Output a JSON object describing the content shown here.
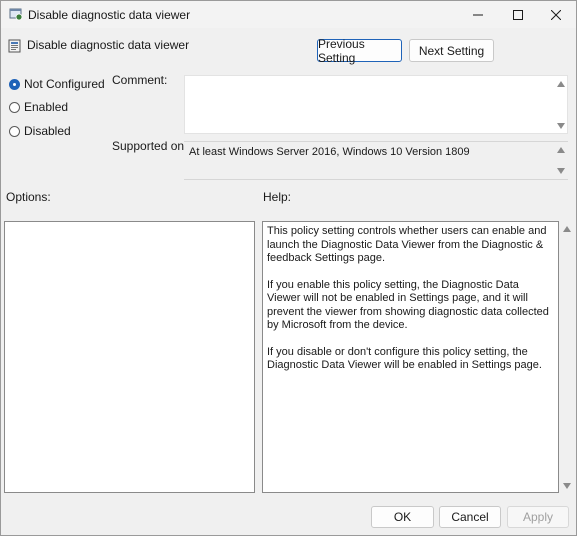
{
  "window": {
    "title": "Disable diagnostic data viewer",
    "icons": {
      "app": "policy-app-icon",
      "minimize": "minimize-icon",
      "maximize": "maximize-icon",
      "close": "close-icon"
    }
  },
  "header": {
    "policy_name": "Disable diagnostic data viewer",
    "policy_icon": "policy-setting-icon",
    "prev_label": "Previous Setting",
    "next_label": "Next Setting"
  },
  "state": {
    "options": [
      {
        "label": "Not Configured",
        "checked": true
      },
      {
        "label": "Enabled",
        "checked": false
      },
      {
        "label": "Disabled",
        "checked": false
      }
    ]
  },
  "comment": {
    "label": "Comment:",
    "value": ""
  },
  "supported": {
    "label": "Supported on:",
    "value": "At least Windows Server 2016, Windows 10 Version 1809"
  },
  "options_panel": {
    "label": "Options:"
  },
  "help_panel": {
    "label": "Help:",
    "paragraphs": [
      "This policy setting controls whether users can enable and launch the Diagnostic Data Viewer from the Diagnostic & feedback Settings page.",
      "If you enable this policy setting, the Diagnostic Data Viewer will not be enabled in Settings page, and it will prevent the viewer from showing diagnostic data collected by Microsoft from the device.",
      "If you disable or don't configure this policy setting, the Diagnostic Data Viewer will be enabled in Settings page."
    ]
  },
  "footer": {
    "ok_label": "OK",
    "cancel_label": "Cancel",
    "apply_label": "Apply"
  },
  "colors": {
    "accent": "#1f63b8",
    "window_bg": "#f0f0f0",
    "disabled_text": "#a0a0a0"
  }
}
